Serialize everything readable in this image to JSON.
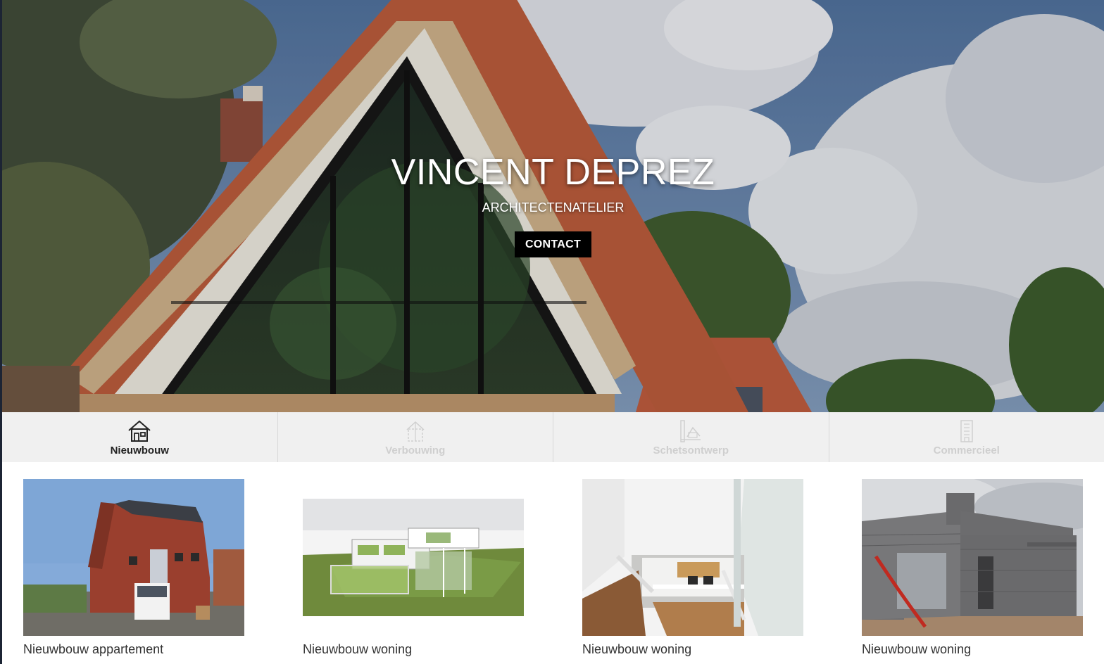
{
  "hero": {
    "title": "VINCENT DEPREZ",
    "subtitle": "ARCHITECTENATELIER",
    "contact_label": "CONTACT"
  },
  "tabs": [
    {
      "label": "Nieuwbouw",
      "icon": "house-icon",
      "active": true
    },
    {
      "label": "Verbouwing",
      "icon": "house-renovation-icon",
      "active": false
    },
    {
      "label": "Schetsontwerp",
      "icon": "sketch-design-icon",
      "active": false
    },
    {
      "label": "Commercieel",
      "icon": "building-icon",
      "active": false
    }
  ],
  "projects": [
    {
      "caption": "Nieuwbouw appartement"
    },
    {
      "caption": "Nieuwbouw woning"
    },
    {
      "caption": "Nieuwbouw woning"
    },
    {
      "caption": "Nieuwbouw woning"
    }
  ],
  "colors": {
    "tab_bar_bg": "#f0f0f0",
    "tab_active": "#222222",
    "tab_inactive": "#cfcfcf",
    "button_bg": "#000000",
    "text": "#333333"
  }
}
